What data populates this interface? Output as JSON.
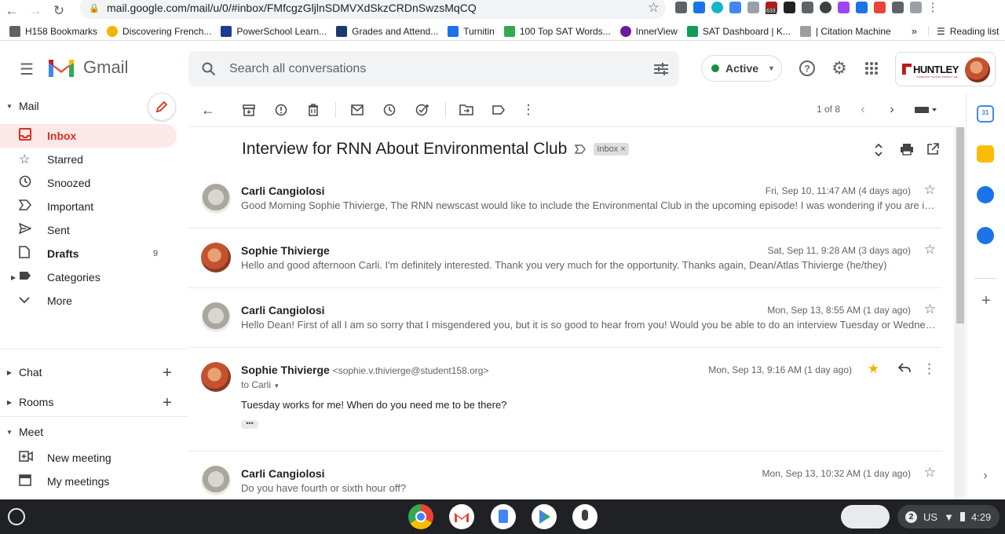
{
  "browser": {
    "url": "mail.google.com/mail/u/0/#inbox/FMfcgzGljlnSDMVXdSkzCRDnSwzsMqCQ",
    "extension_badge": "633",
    "bookmarks": [
      {
        "label": "H158 Bookmarks",
        "color": "#5f6368"
      },
      {
        "label": "Discovering French...",
        "color": "#f4b400"
      },
      {
        "label": "PowerSchool Learn...",
        "color": "#1f3a93"
      },
      {
        "label": "Grades and Attend...",
        "color": "#1a3a6b"
      },
      {
        "label": "Turnitin",
        "color": "#1a73e8"
      },
      {
        "label": "100 Top SAT Words...",
        "color": "#34a853"
      },
      {
        "label": "InnerView",
        "color": "#6a1b9a"
      },
      {
        "label": "SAT Dashboard | K...",
        "color": "#0f9d58"
      },
      {
        "label": "| Citation Machine",
        "color": "#9e9e9e"
      }
    ],
    "reading_list": "Reading list",
    "more_bookmarks": "»"
  },
  "header": {
    "app_name": "Gmail",
    "search_placeholder": "Search all conversations",
    "status": "Active",
    "org_name": "HUNTLEY",
    "org_subtext": "COMMUNITY SCHOOL DISTRICT 158"
  },
  "sidebar": {
    "mail_heading": "Mail",
    "items": [
      {
        "label": "Inbox",
        "count": "",
        "icon": "inbox-icon"
      },
      {
        "label": "Starred",
        "count": "",
        "icon": "star-icon"
      },
      {
        "label": "Snoozed",
        "count": "",
        "icon": "clock-icon"
      },
      {
        "label": "Important",
        "count": "",
        "icon": "important-icon"
      },
      {
        "label": "Sent",
        "count": "",
        "icon": "send-icon"
      },
      {
        "label": "Drafts",
        "count": "9",
        "icon": "draft-icon"
      },
      {
        "label": "Categories",
        "count": "",
        "icon": "label-icon"
      },
      {
        "label": "More",
        "count": "",
        "icon": "chevron-down-icon"
      }
    ],
    "chat_heading": "Chat",
    "rooms_heading": "Rooms",
    "meet_heading": "Meet",
    "meet_items": [
      {
        "label": "New meeting"
      },
      {
        "label": "My meetings"
      }
    ]
  },
  "toolbar": {
    "pager": "1 of 8"
  },
  "thread": {
    "subject": "Interview for RNN About Environmental Club",
    "label": "Inbox",
    "messages": [
      {
        "sender": "Carli Cangiolosi",
        "email": "",
        "date": "Fri, Sep 10, 11:47 AM (4 days ago)",
        "snippet": "Good Morning Sophie Thivierge, The RNN newscast would like to include the Environmental Club in the upcoming episode! I was wondering if you are interested..."
      },
      {
        "sender": "Sophie Thivierge",
        "email": "",
        "date": "Sat, Sep 11, 9:28 AM (3 days ago)",
        "snippet": "Hello and good afternoon Carli. I'm definitely interested. Thank you very much for the opportunity. Thanks again, Dean/Atlas Thivierge (he/they)"
      },
      {
        "sender": "Carli Cangiolosi",
        "email": "",
        "date": "Mon, Sep 13, 8:55 AM (1 day ago)",
        "snippet": "Hello Dean! First of all I am so sorry that I misgendered you, but it is so good to hear from you! Would you be able to do an interview Tuesday or Wednesday..."
      },
      {
        "sender": "Sophie Thivierge",
        "email": "<sophie.v.thivierge@student158.org>",
        "date": "Mon, Sep 13, 9:16 AM (1 day ago)",
        "to": "to Carli",
        "body": "Tuesday works for me! When do you need me to be there?",
        "starred": true
      },
      {
        "sender": "Carli Cangiolosi",
        "email": "",
        "date": "Mon, Sep 13, 10:32 AM (1 day ago)",
        "snippet": "Do you have fourth or sixth hour off?"
      }
    ]
  },
  "taskbar": {
    "notification_count": "2",
    "locale": "US",
    "time": "4:29"
  },
  "colors": {
    "accent_red": "#d93025",
    "active_bg": "#fce8e6",
    "status_green": "#1e8e3e",
    "star_gold": "#f4b400"
  }
}
